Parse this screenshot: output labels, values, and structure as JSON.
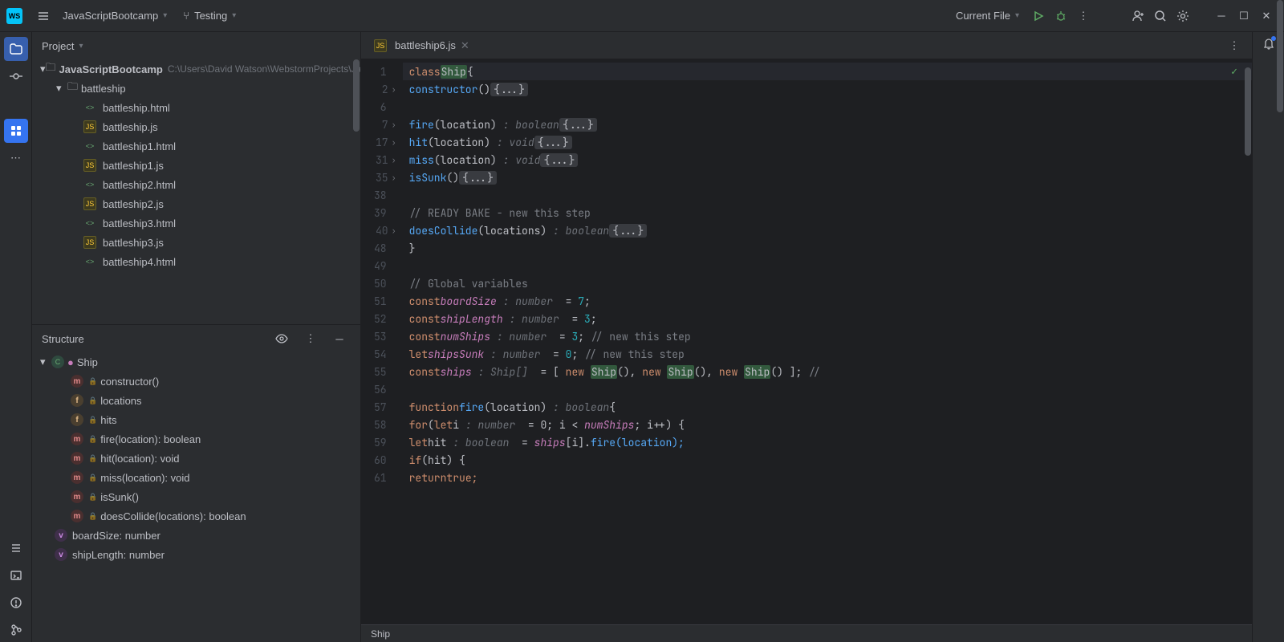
{
  "top": {
    "project_name": "JavaScriptBootcamp",
    "branch": "Testing",
    "run_config": "Current File"
  },
  "project_panel": {
    "title": "Project",
    "root": "JavaScriptBootcamp",
    "root_path": "C:\\Users\\David Watson\\WebstormProjects\\JavaScriptBootcamp",
    "folder": "battleship",
    "files": [
      {
        "name": "battleship.html",
        "type": "html"
      },
      {
        "name": "battleship.js",
        "type": "js"
      },
      {
        "name": "battleship1.html",
        "type": "html"
      },
      {
        "name": "battleship1.js",
        "type": "js"
      },
      {
        "name": "battleship2.html",
        "type": "html"
      },
      {
        "name": "battleship2.js",
        "type": "js"
      },
      {
        "name": "battleship3.html",
        "type": "html"
      },
      {
        "name": "battleship3.js",
        "type": "js"
      },
      {
        "name": "battleship4.html",
        "type": "html"
      }
    ]
  },
  "structure_panel": {
    "title": "Structure",
    "class": "Ship",
    "members": [
      {
        "kind": "m",
        "label": "constructor()"
      },
      {
        "kind": "f",
        "label": "locations"
      },
      {
        "kind": "f",
        "label": "hits"
      },
      {
        "kind": "m",
        "label": "fire(location): boolean"
      },
      {
        "kind": "m",
        "label": "hit(location): void"
      },
      {
        "kind": "m",
        "label": "miss(location): void"
      },
      {
        "kind": "m",
        "label": "isSunk()"
      },
      {
        "kind": "m",
        "label": "doesCollide(locations): boolean"
      }
    ],
    "globals": [
      {
        "kind": "v",
        "label": "boardSize: number"
      },
      {
        "kind": "v",
        "label": "shipLength: number"
      }
    ]
  },
  "editor": {
    "tab_name": "battleship6.js",
    "breadcrumb": "Ship",
    "lines": [
      {
        "n": 1
      },
      {
        "n": 2,
        "fold": true
      },
      {
        "n": 6
      },
      {
        "n": 7,
        "fold": true
      },
      {
        "n": 17,
        "fold": true
      },
      {
        "n": 31,
        "fold": true
      },
      {
        "n": 35,
        "fold": true
      },
      {
        "n": 38
      },
      {
        "n": 39
      },
      {
        "n": 40,
        "fold": true
      },
      {
        "n": 48
      },
      {
        "n": 49
      },
      {
        "n": 50
      },
      {
        "n": 51
      },
      {
        "n": 52
      },
      {
        "n": 53
      },
      {
        "n": 54
      },
      {
        "n": 55
      },
      {
        "n": 56
      },
      {
        "n": 57
      },
      {
        "n": 58
      },
      {
        "n": 59
      },
      {
        "n": 60
      },
      {
        "n": 61
      }
    ],
    "tokens": {
      "class": "class",
      "ship": "Ship",
      "brace_open": "{",
      "constructor": "constructor",
      "parens": "()",
      "folded": "{...}",
      "fire": "fire",
      "hit": "hit",
      "miss": "miss",
      "isSunk": "isSunk",
      "location_p": "(location)",
      "locations_p": "(locations)",
      "bool_t": " : boolean",
      "void_t": " : void",
      "ready_comment": "// READY BAKE - new this step",
      "doesCollide": "doesCollide",
      "brace_close": "}",
      "globals_comment": "// Global variables",
      "const": "const",
      "let": "let",
      "boardSize": "boardSize",
      "shipLength": "shipLength",
      "numShips": "numShips",
      "shipsSunk": "shipsSunk",
      "ships": "ships",
      "number_t": " : number",
      "ship_arr_t": " : Ship[]",
      "eq": "  = ",
      "seven": "7",
      "three": "3",
      "zero": "0",
      "semi": ";",
      "new_this_step": " // new this step",
      "arr_open": "[ ",
      "new": "new ",
      "ship_call": "()",
      "comma": ", ",
      "arr_close": " ];",
      "trailing": " //",
      "function": "function",
      "for": "for",
      "if": "if",
      "return": "return",
      "true": "true",
      "let_kw": "let",
      "i_var": "i",
      "i_init": "  = 0; ",
      "i_cond": "i < ",
      "i_inc": "; i++) {",
      "hit_var": "hit",
      "hit_assign": "  = ",
      "ships_idx": "ships",
      "idx": "[i].",
      "fire_call": "fire(location);",
      "if_cond": "(hit) {",
      "return_true": "true;",
      "fn_sig_open": "(",
      "fn_sig_close": ")  ",
      "brace_sp": " {"
    }
  }
}
